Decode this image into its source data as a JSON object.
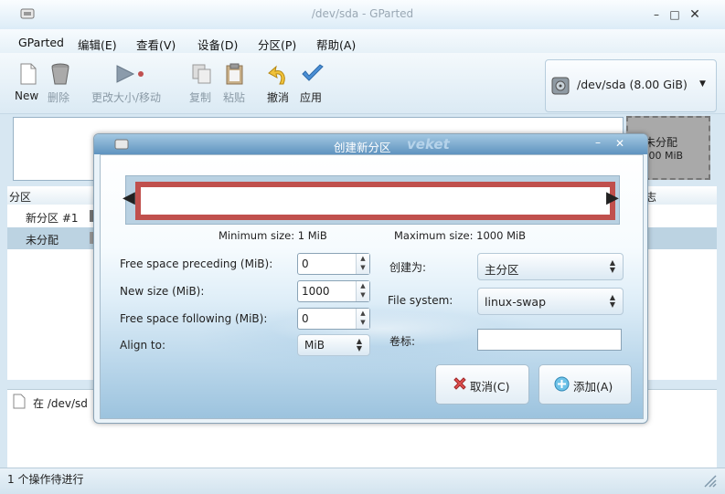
{
  "window": {
    "title": "/dev/sda - GParted"
  },
  "menu": {
    "items": [
      "GParted",
      "编辑(E)",
      "查看(V)",
      "设备(D)",
      "分区(P)",
      "帮助(A)"
    ]
  },
  "toolbar": {
    "new": "New",
    "delete": "删除",
    "resize": "更改大小/移动",
    "copy": "复制",
    "paste": "粘贴",
    "undo": "撤消",
    "apply": "应用"
  },
  "device": {
    "selected": "/dev/sda  (8.00 GiB)"
  },
  "graph": {
    "unallocated_label": "未分配",
    "unallocated_size": "8.00 MiB"
  },
  "partition_list": {
    "col_partition": "分区",
    "col_flags_partial": "志",
    "rows": [
      "新分区 #1",
      "未分配"
    ]
  },
  "operations": {
    "item": "在 /dev/sd"
  },
  "statusbar": {
    "text": "1 个操作待进行"
  },
  "dialog": {
    "title": "创建新分区",
    "watermark": "veket",
    "min_size": "Minimum size: 1 MiB",
    "max_size": "Maximum size: 1000 MiB",
    "free_preceding_label": "Free space preceding (MiB):",
    "free_preceding_value": "0",
    "new_size_label": "New size (MiB):",
    "new_size_value": "1000",
    "free_following_label": "Free space following (MiB):",
    "free_following_value": "0",
    "align_label": "Align to:",
    "align_value": "MiB",
    "create_as_label": "创建为:",
    "create_as_value": "主分区",
    "filesystem_label": "File system:",
    "filesystem_value": "linux-swap",
    "label_label": "卷标:",
    "label_value": "",
    "cancel_button": "取消(C)",
    "add_button": "添加(A)"
  },
  "colors": {
    "partition_border": "#c0504d",
    "accent": "#5f93bf"
  }
}
